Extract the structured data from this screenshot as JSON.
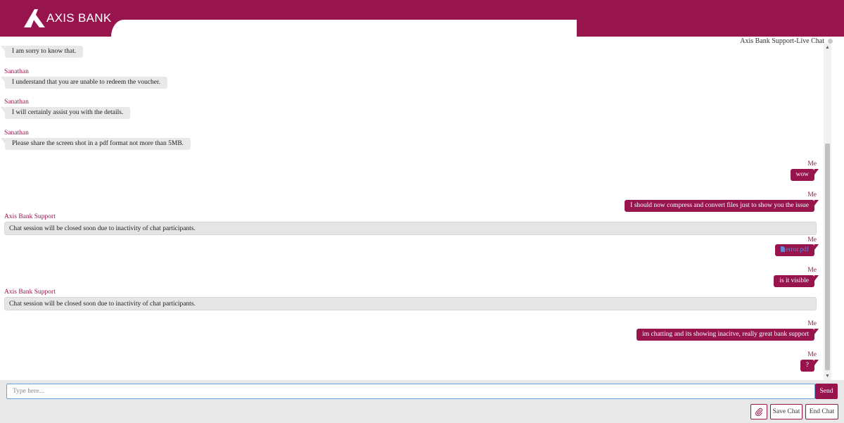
{
  "header": {
    "brand_name": "AXIS BANK",
    "brand_color": "#97144d"
  },
  "chat": {
    "title": "Axis Bank Support-Live Chat",
    "messages": [
      {
        "sender": "",
        "text": "I am sorry to know that.",
        "side": "agent"
      },
      {
        "sender": "Sanathan",
        "text": "I understand that you are unable to redeem the voucher.",
        "side": "agent"
      },
      {
        "sender": "Sanathan",
        "text": "I will certainly assist you with the details.",
        "side": "agent"
      },
      {
        "sender": "Sanathan",
        "text": "Please share the screen shot in a pdf format not more than 5MB.",
        "side": "agent"
      },
      {
        "sender": "Me",
        "text": "wow",
        "side": "me"
      },
      {
        "sender": "Me",
        "text": "I should now compress and convert files just to show you the issue",
        "side": "me"
      },
      {
        "sender": "Axis Bank Support",
        "text": "Chat session will be closed soon due to inactivity of chat participants.",
        "side": "system"
      },
      {
        "sender": "Me",
        "text": "error.pdf",
        "side": "me",
        "icon": "file-icon"
      },
      {
        "sender": "Me",
        "text": "is it visible",
        "side": "me"
      },
      {
        "sender": "Axis Bank Support",
        "text": "Chat session will be closed soon due to inactivity of chat participants.",
        "side": "system"
      },
      {
        "sender": "Me",
        "text": "im chatting and its showing inacitve, really great bank support",
        "side": "me"
      },
      {
        "sender": "Me",
        "text": "?",
        "side": "me"
      }
    ]
  },
  "composer": {
    "placeholder": "Type here...",
    "send_label": "Send",
    "attach_icon": "paperclip-icon",
    "save_label": "Save Chat",
    "end_label": "End Chat"
  }
}
